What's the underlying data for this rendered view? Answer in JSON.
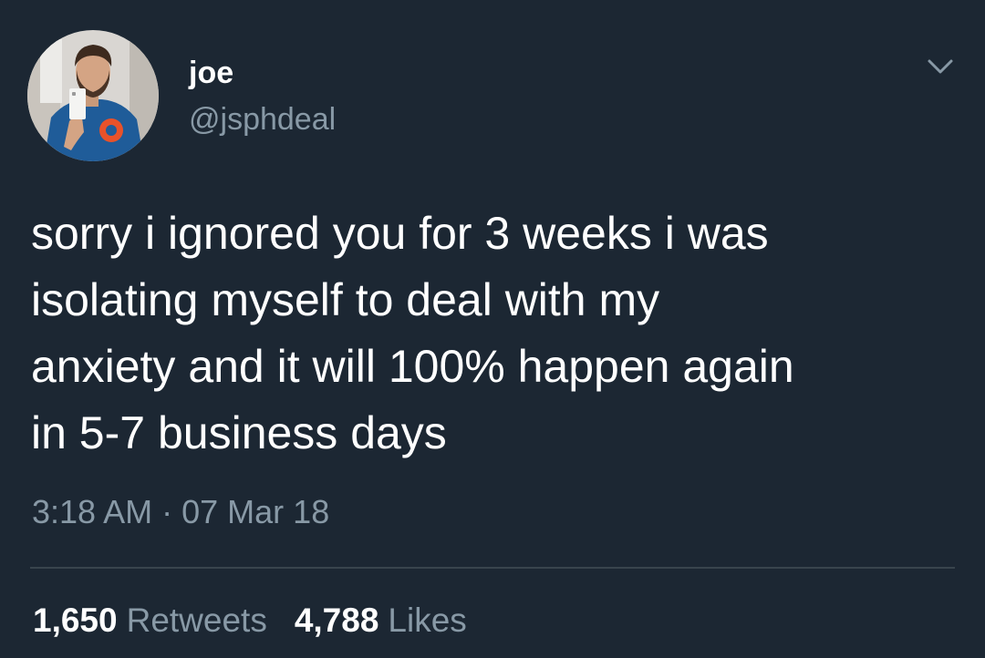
{
  "tweet": {
    "author": {
      "name": "joe",
      "handle": "@jsphdeal"
    },
    "text": "sorry i ignored you for 3 weeks i was\nisolating myself to deal with my\nanxiety and it will 100% happen again\nin 5-7 business days",
    "time": "3:18 AM",
    "separator": "·",
    "date": "07 Mar 18",
    "stats": {
      "retweets_count": "1,650",
      "retweets_label": "Retweets",
      "likes_count": "4,788",
      "likes_label": "Likes"
    }
  },
  "icons": {
    "menu": "chevron-down-icon",
    "avatar": "profile-photo"
  },
  "colors": {
    "background": "#1c2733",
    "primary_text": "#ffffff",
    "secondary_text": "#8899a6",
    "divider": "#38444d"
  }
}
